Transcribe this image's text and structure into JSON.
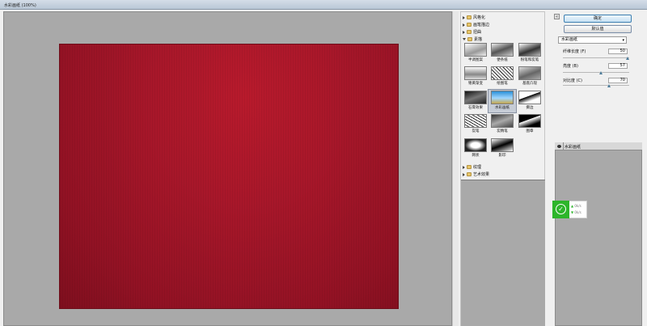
{
  "window": {
    "title": "水彩画纸 (100%)"
  },
  "gallery": {
    "categories": [
      {
        "label": "风格化",
        "expanded": false
      },
      {
        "label": "画笔描边",
        "expanded": false
      },
      {
        "label": "扭曲",
        "expanded": false
      },
      {
        "label": "素描",
        "expanded": true
      },
      {
        "label": "纹理",
        "expanded": false
      },
      {
        "label": "艺术效果",
        "expanded": false
      }
    ],
    "sketch_filters": [
      {
        "label": "半调图案"
      },
      {
        "label": "便条纸"
      },
      {
        "label": "粉笔和炭笔"
      },
      {
        "label": "铬黄渐变"
      },
      {
        "label": "绘图笔"
      },
      {
        "label": "基底凸现"
      },
      {
        "label": "石膏效果"
      },
      {
        "label": "水彩画纸",
        "selected": true
      },
      {
        "label": "撕边"
      },
      {
        "label": "炭笔"
      },
      {
        "label": "炭精笔"
      },
      {
        "label": "图章"
      },
      {
        "label": "网状"
      },
      {
        "label": "影印"
      }
    ]
  },
  "buttons": {
    "ok": "确定",
    "reset": "默认值"
  },
  "filter_select": {
    "value": "水彩画纸"
  },
  "params": [
    {
      "label": "纤维长度 (F)",
      "value": "50",
      "fraction": 0.98
    },
    {
      "label": "亮度 (B)",
      "value": "57",
      "fraction": 0.57
    },
    {
      "label": "对比度 (C)",
      "value": "70",
      "fraction": 0.7
    }
  ],
  "layers": {
    "effect_layer": "水彩画纸"
  },
  "overlay": {
    "up_value": "0k/s",
    "down_value": "0k/s"
  },
  "colors": {
    "canvas_red": "#a8172a",
    "preview_bg": "#a9a9a9",
    "accent_green": "#2db52a"
  }
}
